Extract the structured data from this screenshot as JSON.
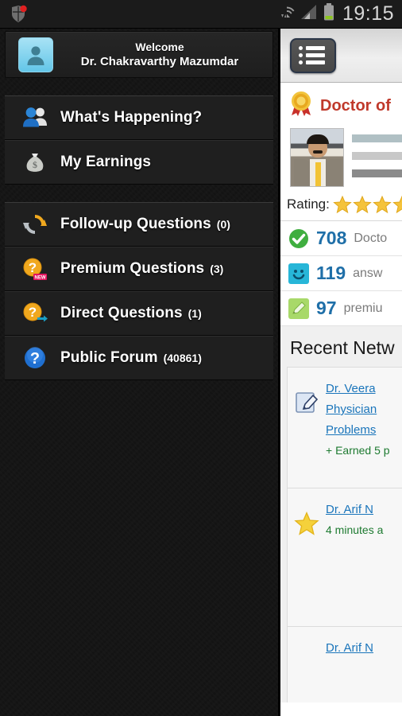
{
  "statusbar": {
    "time": "19:15",
    "icons": [
      "shield-notification-icon",
      "wifi-icon",
      "cellular-signal-icon",
      "battery-icon"
    ]
  },
  "sidebar": {
    "profile": {
      "avatar_icon": "user-avatar-icon",
      "welcome_label": "Welcome",
      "doctor_name": "Dr. Chakravarthy Mazumdar"
    },
    "groups": [
      {
        "items": [
          {
            "icon": "people-icon",
            "label": "What's Happening?",
            "count": ""
          },
          {
            "icon": "money-bag-icon",
            "label": "My Earnings",
            "count": ""
          }
        ]
      },
      {
        "items": [
          {
            "icon": "refresh-icon",
            "label": "Follow-up Questions",
            "count": "(0)"
          },
          {
            "icon": "question-new-icon",
            "label": "Premium Questions",
            "count": "(3)"
          },
          {
            "icon": "question-arrow-icon",
            "label": "Direct Questions",
            "count": "(1)"
          },
          {
            "icon": "question-blue-icon",
            "label": "Public Forum",
            "count": "(40861)"
          }
        ]
      }
    ]
  },
  "content": {
    "actionbar": {
      "menu_button_icon": "list-menu-icon"
    },
    "badge": {
      "icon": "gold-medal-icon",
      "title": "Doctor of"
    },
    "profile_photo": "doctor-portrait-photo",
    "rating": {
      "label": "Rating:",
      "star_icon": "star-icon",
      "stars_shown": 4
    },
    "stats": [
      {
        "icon": "green-check-icon",
        "number": "708",
        "text": "Docto"
      },
      {
        "icon": "smiley-icon",
        "number": "119",
        "text": "answ"
      },
      {
        "icon": "green-pencil-icon",
        "number": "97",
        "text": "premiu"
      }
    ],
    "section_title": "Recent Netw",
    "feed": [
      {
        "icon": "note-edit-icon",
        "links": [
          "Dr. Veera ",
          "Physician",
          "Problems"
        ],
        "meta": "+ Earned 5 p"
      },
      {
        "icon": "star-icon",
        "links": [
          "Dr. Arif N "
        ],
        "meta": "4 minutes a"
      },
      {
        "icon": "",
        "links": [
          "Dr. Arif N "
        ],
        "meta": ""
      }
    ]
  },
  "colors": {
    "accent_red": "#c0392b",
    "link_blue": "#1a75bb",
    "stat_blue": "#1f6fa8",
    "meta_green": "#1d7a30",
    "star_gold": "#f5c33b"
  }
}
